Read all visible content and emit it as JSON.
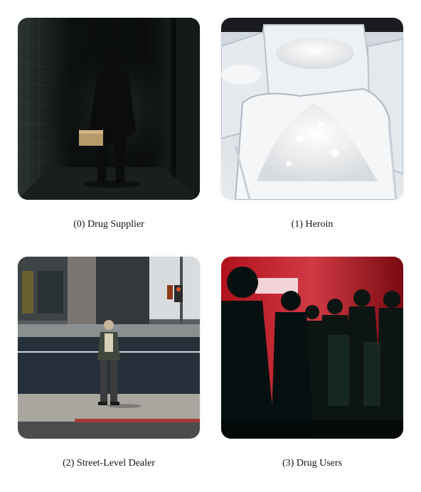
{
  "panels": [
    {
      "caption": "(0) Drug Supplier",
      "image": "hooded-figure-in-dark-alley-photo"
    },
    {
      "caption": "(1) Heroin",
      "image": "bags-of-white-powder-photo"
    },
    {
      "caption": "(2) Street-Level Dealer",
      "image": "man-standing-on-street-corner-photo"
    },
    {
      "caption": "(3) Drug Users",
      "image": "crowd-silhouettes-red-light-photo"
    }
  ]
}
